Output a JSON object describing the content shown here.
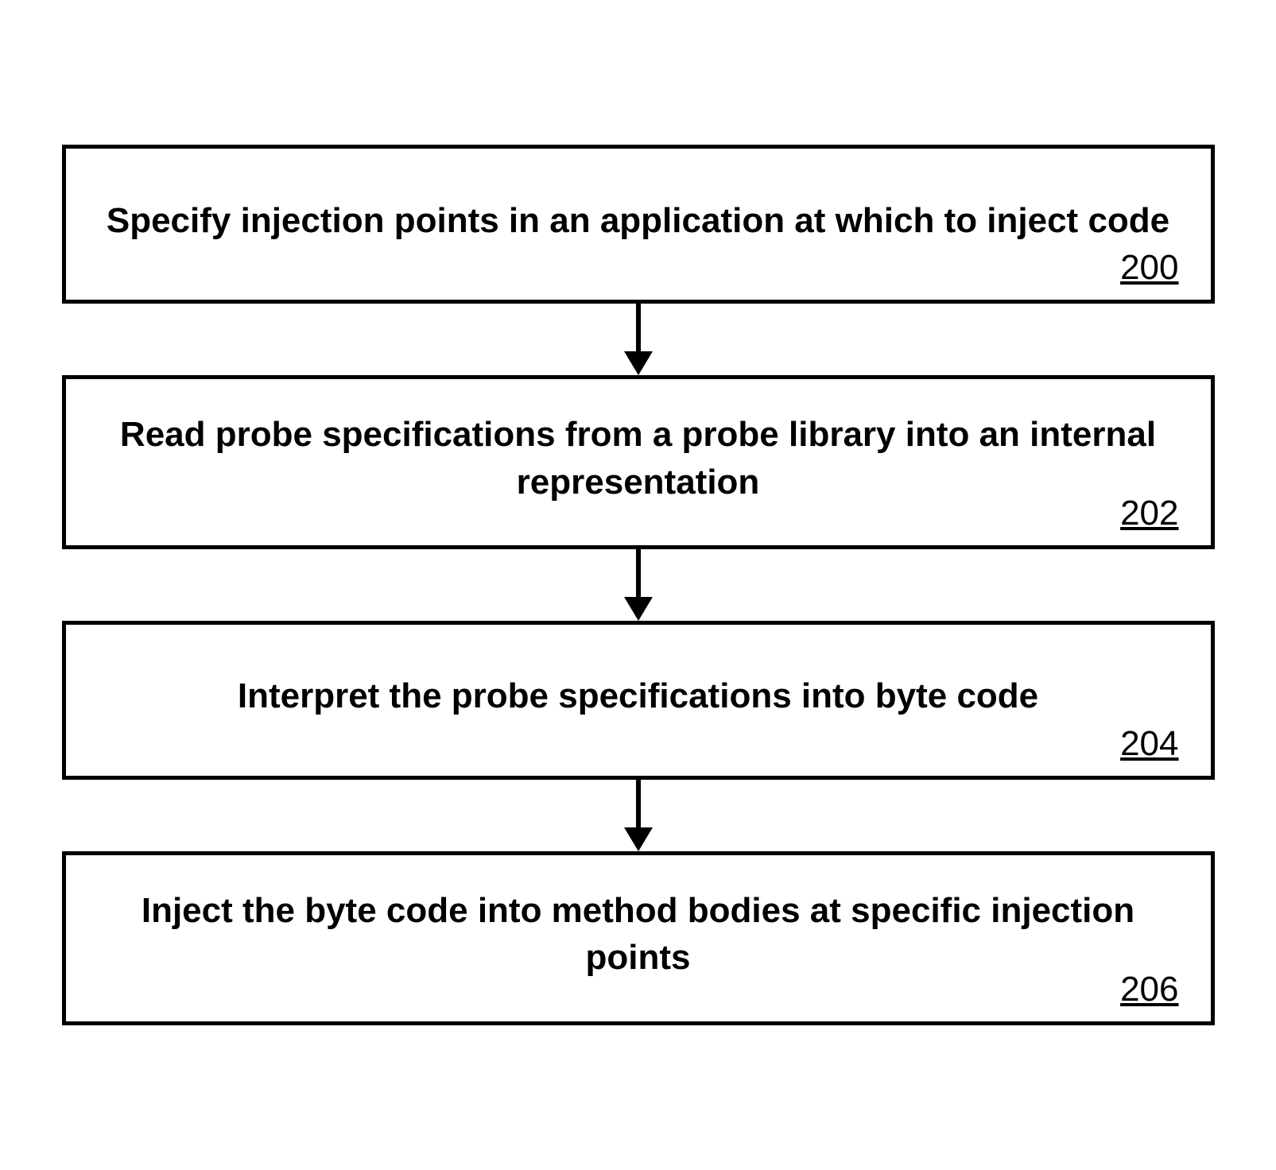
{
  "flowchart": {
    "steps": [
      {
        "text": "Specify injection points in an application at which to inject code",
        "number": "200"
      },
      {
        "text": "Read probe specifications from a probe library into an internal representation",
        "number": "202"
      },
      {
        "text": "Interpret the probe specifications into byte code",
        "number": "204"
      },
      {
        "text": "Inject the byte code into method bodies at specific injection points",
        "number": "206"
      }
    ]
  }
}
